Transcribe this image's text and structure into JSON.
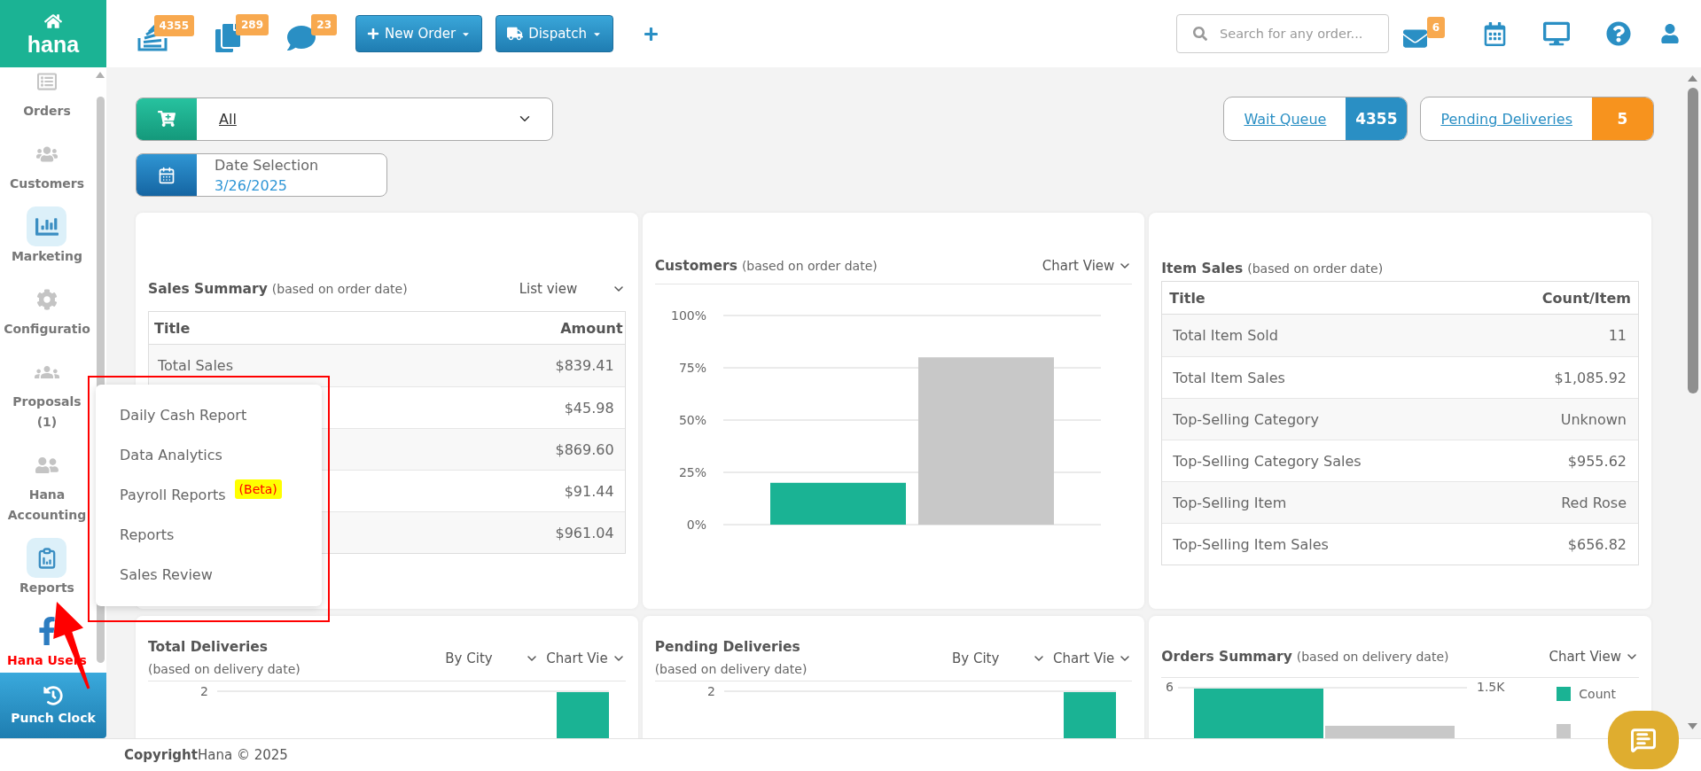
{
  "brand": {
    "name": "hana"
  },
  "toolbar": {
    "counters": [
      {
        "kind": "stack",
        "badge": "4355"
      },
      {
        "kind": "copy",
        "badge": "289"
      },
      {
        "kind": "chat",
        "badge": "23"
      }
    ],
    "actions": [
      {
        "kind": "new",
        "label": "New Order"
      },
      {
        "kind": "dispatch",
        "label": "Dispatch"
      }
    ],
    "search": {
      "placeholder": "Search for any order..."
    },
    "mail": {
      "badge": "6"
    }
  },
  "sidebar": {
    "items": [
      {
        "kind": "orders",
        "label": "Orders",
        "highlighted": false
      },
      {
        "kind": "customers",
        "label": "Customers",
        "highlighted": false
      },
      {
        "kind": "marketing",
        "label": "Marketing",
        "highlighted": true
      },
      {
        "kind": "configuration",
        "label": "Configuratio",
        "highlighted": false
      },
      {
        "kind": "proposals",
        "label": "Proposals (1)",
        "highlighted": false
      },
      {
        "kind": "accounting",
        "label": "Hana Accounting",
        "highlighted": false
      },
      {
        "kind": "reports",
        "label": "Reports",
        "highlighted": true
      },
      {
        "kind": "facebook",
        "label": "Hana Users",
        "highlighted": false
      }
    ],
    "punch_clock": {
      "label": "Punch Clock"
    }
  },
  "reports_menu": {
    "items": [
      {
        "label": "Daily Cash Report"
      },
      {
        "label": "Data Analytics"
      },
      {
        "label": "Payroll Reports",
        "badge": "(Beta)"
      },
      {
        "label": "Reports"
      },
      {
        "label": "Sales Review"
      }
    ]
  },
  "filters": {
    "store": {
      "value": "All"
    },
    "date": {
      "label": "Date Selection",
      "value": "3/26/2025"
    }
  },
  "queues": [
    {
      "label": "Wait Queue",
      "count": "4355",
      "color": "#2a8fc4"
    },
    {
      "label": "Pending Deliveries",
      "count": "5",
      "color": "#f7931e"
    }
  ],
  "sales_summary": {
    "title": "Sales Summary",
    "note": "(based on order date)",
    "view": "List view",
    "columns": [
      "Title",
      "Amount"
    ],
    "rows": [
      {
        "title": "Total Sales",
        "value": "$839.41"
      },
      {
        "value": "$45.98"
      },
      {
        "value": "$869.60"
      },
      {
        "value": "$91.44"
      },
      {
        "value": "$961.04"
      }
    ]
  },
  "customers": {
    "title": "Customers",
    "note": "(based on order date)",
    "view": "Chart View",
    "chart_data": {
      "type": "bar",
      "grid": true,
      "ylim": [
        0,
        100
      ],
      "yticks": [
        {
          "value": 0,
          "label": "0%"
        },
        {
          "value": 25,
          "label": "25%"
        },
        {
          "value": 50,
          "label": "50%"
        },
        {
          "value": 75,
          "label": "75%"
        },
        {
          "value": 100,
          "label": "100%"
        }
      ],
      "series": [
        {
          "color": "#1ab394",
          "values": [
            20
          ]
        },
        {
          "color": "#c8c8c8",
          "values": [
            80
          ]
        }
      ]
    }
  },
  "item_sales": {
    "title": "Item Sales",
    "note": "(based on order date)",
    "columns": [
      "Title",
      "Count/Item"
    ],
    "rows": [
      {
        "title": "Total Item Sold",
        "value": "11"
      },
      {
        "title": "Total Item Sales",
        "value": "$1,085.92"
      },
      {
        "title": "Top-Selling Category",
        "value": "Unknown"
      },
      {
        "title": "Top-Selling Category Sales",
        "value": "$955.62"
      },
      {
        "title": "Top-Selling Item",
        "value": "Red Rose"
      },
      {
        "title": "Top-Selling Item Sales",
        "value": "$656.82"
      }
    ]
  },
  "total_deliveries": {
    "title": "Total Deliveries",
    "note": "(based on delivery date)",
    "group": "By City",
    "view": "Chart Vie",
    "y_tick": "2"
  },
  "pending_deliveries": {
    "title": "Pending Deliveries",
    "note": "(based on delivery date)",
    "group": "By City",
    "view": "Chart Vie",
    "y_tick": "2"
  },
  "orders_summary": {
    "title": "Orders Summary",
    "note": "(based on delivery date)",
    "view": "Chart View",
    "left_tick": "6",
    "right_tick": "1.5K",
    "legend": [
      {
        "label": "Count",
        "color": "#1ab394"
      },
      {
        "color": "#c8c8c8"
      }
    ]
  },
  "footer": {
    "text": "**Copyright**Hana © 2025"
  }
}
